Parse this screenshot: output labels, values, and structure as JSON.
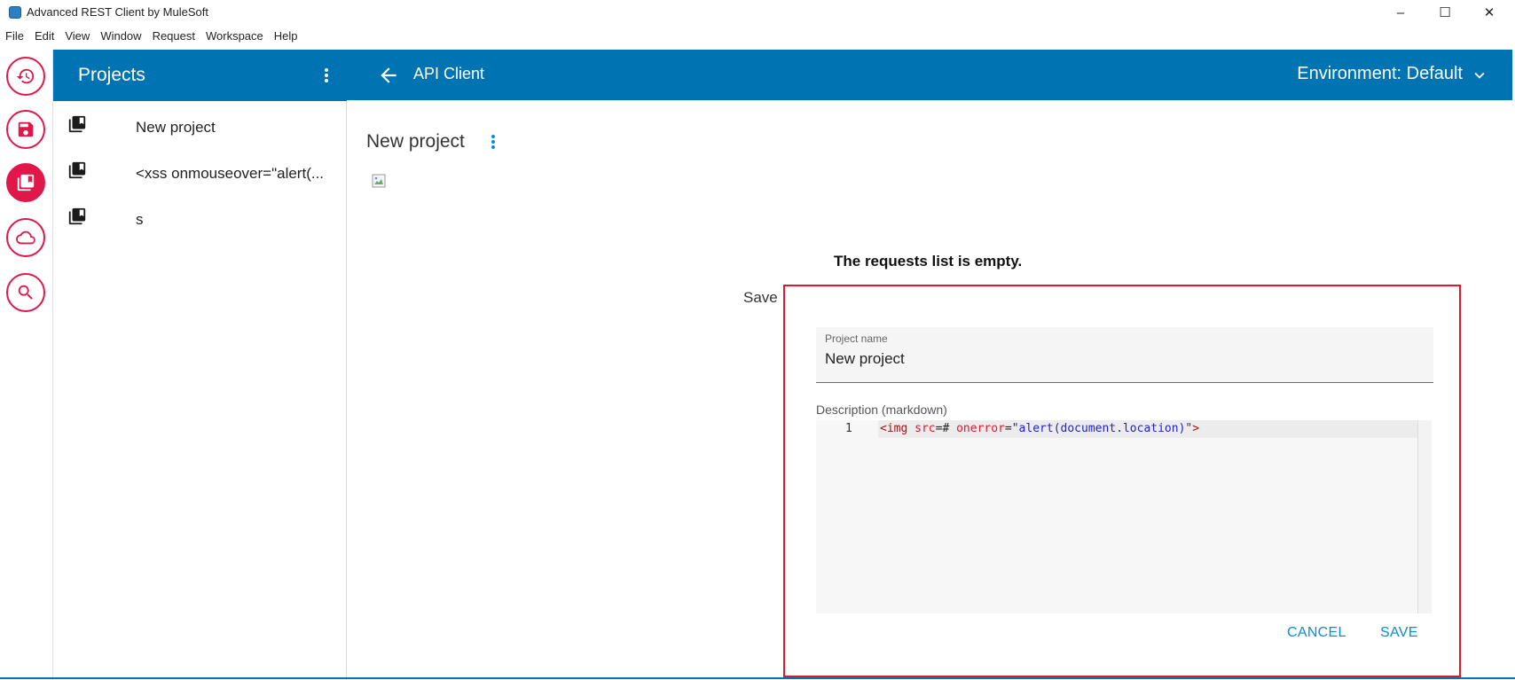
{
  "window": {
    "title": "Advanced REST Client by MuleSoft",
    "controls": {
      "minimize": "–",
      "maximize": "☐",
      "close": "✕"
    }
  },
  "menu": [
    "File",
    "Edit",
    "View",
    "Window",
    "Request",
    "Workspace",
    "Help"
  ],
  "rail": {
    "items": [
      {
        "name": "history",
        "icon": "history-icon"
      },
      {
        "name": "saved",
        "icon": "save-icon"
      },
      {
        "name": "projects",
        "icon": "projects-icon",
        "active": true
      },
      {
        "name": "drive",
        "icon": "cloud-icon"
      },
      {
        "name": "search",
        "icon": "search-icon"
      }
    ],
    "accent": "#e0184a"
  },
  "projects_panel": {
    "title": "Projects",
    "items": [
      {
        "label": "New project"
      },
      {
        "label": "<xss onmouseover=\"alert(..."
      },
      {
        "label": "s"
      }
    ]
  },
  "header": {
    "title": "API Client",
    "environment": "Environment: Default",
    "color": "#0074b3"
  },
  "main": {
    "project_title": "New project",
    "empty_message": "The requests list is empty.",
    "save_hint": "Save"
  },
  "dialog": {
    "name_label": "Project name",
    "name_value": "New project",
    "description_label": "Description (markdown)",
    "line_number": "1",
    "code_tokens": {
      "t1": "<img",
      "t2": " ",
      "t3": "src",
      "t4": "=# ",
      "t5": "onerror",
      "t6": "=",
      "t7": "\"alert(document.location)\"",
      "t8": ">"
    },
    "cancel_label": "CANCEL",
    "save_label": "SAVE",
    "border_color": "#e0182d"
  }
}
